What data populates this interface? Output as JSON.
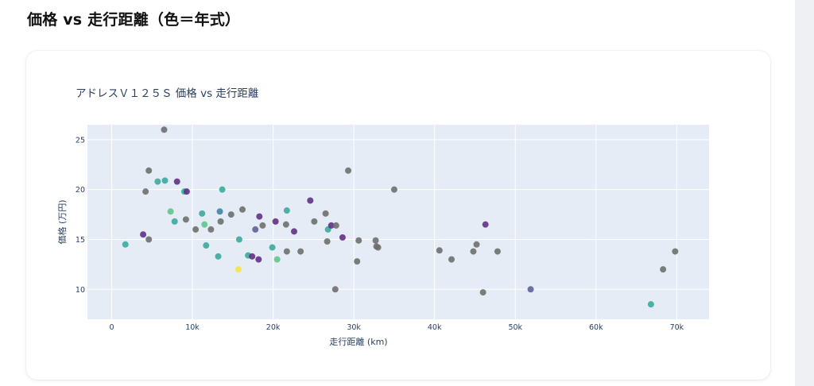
{
  "page": {
    "heading": "価格 vs 走行距離（色＝年式）"
  },
  "chart_data": {
    "type": "scatter",
    "title": "アドレスＶ１２５Ｓ 価格 vs 走行距離",
    "xlabel": "走行距離 (km)",
    "ylabel": "価格 (万円)",
    "xlim": [
      -3000,
      74000
    ],
    "ylim": [
      7,
      26.5
    ],
    "x_ticks": [
      0,
      10000,
      20000,
      30000,
      40000,
      50000,
      60000,
      70000
    ],
    "x_tick_labels": [
      "0",
      "10k",
      "20k",
      "30k",
      "40k",
      "50k",
      "60k",
      "70k"
    ],
    "y_ticks": [
      10,
      15,
      20,
      25
    ],
    "y_tick_labels": [
      "10",
      "15",
      "20",
      "25"
    ],
    "grid": true,
    "legend": "none",
    "colors": {
      "plot_bg": "#e5ecf6",
      "grid": "#ffffff",
      "gray": "#6b6b6b",
      "purple": "#5e2a84",
      "slate": "#5b5d96",
      "blue": "#3f7ea6",
      "teal": "#35a89a",
      "green": "#5cc48a",
      "yellow": "#f5e34a"
    },
    "points": [
      {
        "x": 1700,
        "y": 14.5,
        "c": "teal"
      },
      {
        "x": 3900,
        "y": 15.5,
        "c": "purple"
      },
      {
        "x": 4200,
        "y": 19.8,
        "c": "gray"
      },
      {
        "x": 4600,
        "y": 21.9,
        "c": "gray"
      },
      {
        "x": 4600,
        "y": 15.0,
        "c": "gray"
      },
      {
        "x": 5700,
        "y": 20.8,
        "c": "teal"
      },
      {
        "x": 6500,
        "y": 26.0,
        "c": "gray"
      },
      {
        "x": 6600,
        "y": 20.9,
        "c": "teal"
      },
      {
        "x": 7300,
        "y": 17.8,
        "c": "green"
      },
      {
        "x": 7800,
        "y": 16.8,
        "c": "teal"
      },
      {
        "x": 8100,
        "y": 20.8,
        "c": "purple"
      },
      {
        "x": 9000,
        "y": 19.8,
        "c": "teal"
      },
      {
        "x": 9300,
        "y": 19.8,
        "c": "purple"
      },
      {
        "x": 9200,
        "y": 17.0,
        "c": "gray"
      },
      {
        "x": 10400,
        "y": 16.0,
        "c": "gray"
      },
      {
        "x": 11200,
        "y": 17.6,
        "c": "teal"
      },
      {
        "x": 11500,
        "y": 16.5,
        "c": "green"
      },
      {
        "x": 11700,
        "y": 14.4,
        "c": "teal"
      },
      {
        "x": 12300,
        "y": 16.0,
        "c": "gray"
      },
      {
        "x": 13200,
        "y": 13.3,
        "c": "teal"
      },
      {
        "x": 13400,
        "y": 17.8,
        "c": "blue"
      },
      {
        "x": 13500,
        "y": 16.8,
        "c": "gray"
      },
      {
        "x": 13700,
        "y": 20.0,
        "c": "teal"
      },
      {
        "x": 14800,
        "y": 17.5,
        "c": "gray"
      },
      {
        "x": 15700,
        "y": 12.0,
        "c": "yellow"
      },
      {
        "x": 15800,
        "y": 15.0,
        "c": "teal"
      },
      {
        "x": 16200,
        "y": 18.0,
        "c": "gray"
      },
      {
        "x": 16900,
        "y": 13.4,
        "c": "teal"
      },
      {
        "x": 17400,
        "y": 13.3,
        "c": "purple"
      },
      {
        "x": 17800,
        "y": 16.0,
        "c": "slate"
      },
      {
        "x": 18200,
        "y": 13.0,
        "c": "purple"
      },
      {
        "x": 18300,
        "y": 17.3,
        "c": "purple"
      },
      {
        "x": 18700,
        "y": 16.4,
        "c": "gray"
      },
      {
        "x": 19900,
        "y": 14.2,
        "c": "teal"
      },
      {
        "x": 20300,
        "y": 16.8,
        "c": "purple"
      },
      {
        "x": 20500,
        "y": 13.0,
        "c": "green"
      },
      {
        "x": 21600,
        "y": 16.5,
        "c": "gray"
      },
      {
        "x": 21700,
        "y": 17.9,
        "c": "teal"
      },
      {
        "x": 21700,
        "y": 13.8,
        "c": "gray"
      },
      {
        "x": 22600,
        "y": 15.8,
        "c": "purple"
      },
      {
        "x": 23400,
        "y": 13.8,
        "c": "gray"
      },
      {
        "x": 24600,
        "y": 18.9,
        "c": "purple"
      },
      {
        "x": 25100,
        "y": 16.8,
        "c": "gray"
      },
      {
        "x": 26500,
        "y": 17.6,
        "c": "gray"
      },
      {
        "x": 26700,
        "y": 14.8,
        "c": "gray"
      },
      {
        "x": 26800,
        "y": 16.0,
        "c": "teal"
      },
      {
        "x": 27200,
        "y": 16.4,
        "c": "purple"
      },
      {
        "x": 27800,
        "y": 16.4,
        "c": "gray"
      },
      {
        "x": 27700,
        "y": 10.0,
        "c": "gray"
      },
      {
        "x": 28600,
        "y": 15.2,
        "c": "purple"
      },
      {
        "x": 29300,
        "y": 21.9,
        "c": "gray"
      },
      {
        "x": 30400,
        "y": 12.8,
        "c": "gray"
      },
      {
        "x": 30600,
        "y": 14.9,
        "c": "gray"
      },
      {
        "x": 32700,
        "y": 14.9,
        "c": "gray"
      },
      {
        "x": 32800,
        "y": 14.3,
        "c": "gray"
      },
      {
        "x": 33000,
        "y": 14.2,
        "c": "gray"
      },
      {
        "x": 35000,
        "y": 20.0,
        "c": "gray"
      },
      {
        "x": 40600,
        "y": 13.9,
        "c": "gray"
      },
      {
        "x": 42100,
        "y": 13.0,
        "c": "gray"
      },
      {
        "x": 44800,
        "y": 13.8,
        "c": "gray"
      },
      {
        "x": 45200,
        "y": 14.5,
        "c": "gray"
      },
      {
        "x": 46000,
        "y": 9.7,
        "c": "gray"
      },
      {
        "x": 46300,
        "y": 16.5,
        "c": "purple"
      },
      {
        "x": 47800,
        "y": 13.8,
        "c": "gray"
      },
      {
        "x": 51900,
        "y": 10.0,
        "c": "slate"
      },
      {
        "x": 66800,
        "y": 8.5,
        "c": "teal"
      },
      {
        "x": 68300,
        "y": 12.0,
        "c": "gray"
      },
      {
        "x": 69800,
        "y": 13.8,
        "c": "gray"
      }
    ]
  }
}
